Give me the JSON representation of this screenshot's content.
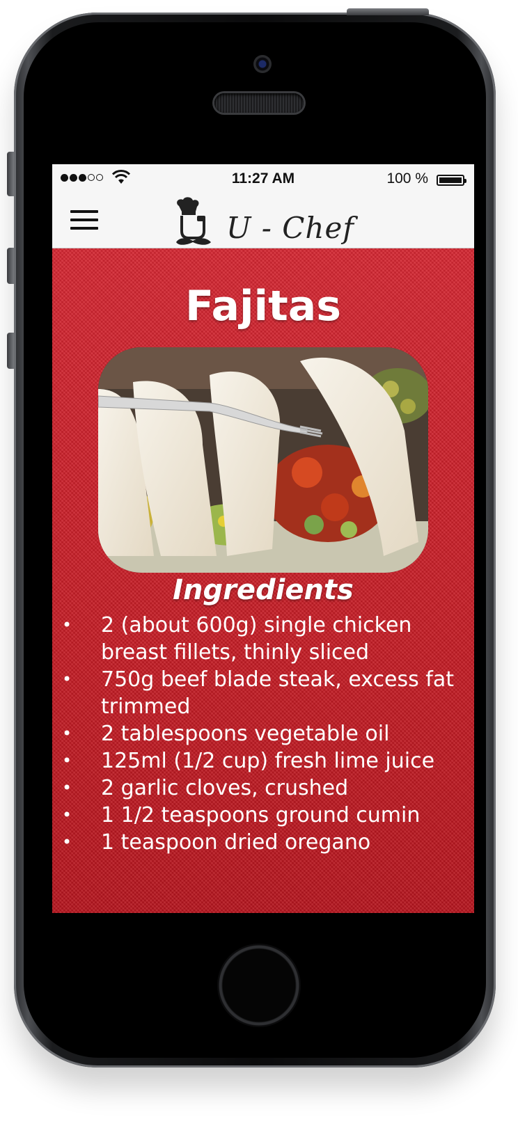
{
  "status_bar": {
    "time": "11:27 AM",
    "battery": "100 %",
    "signal_bars": 3,
    "signal_total": 5
  },
  "nav": {
    "app_name": "U - Chef",
    "menu_icon": "hamburger-menu-icon",
    "logo_icon": "chef-hat-mustache-icon"
  },
  "recipe": {
    "title": "Fajitas",
    "image_alt_icon": "fajitas-photo",
    "ingredients_heading": "Ingredients",
    "ingredients": [
      "2 (about 600g) single chicken breast fillets, thinly sliced",
      "750g beef blade steak, excess fat trimmed",
      "2 tablespoons vegetable oil",
      "125ml (1/2 cup) fresh lime juice",
      "2 garlic cloves, crushed",
      "1 1/2 teaspoons ground cumin",
      "1 teaspoon dried oregano"
    ]
  },
  "colors": {
    "accent": "#c81a23",
    "nav_bg": "#f6f6f6",
    "text_on_accent": "#ffffff"
  }
}
